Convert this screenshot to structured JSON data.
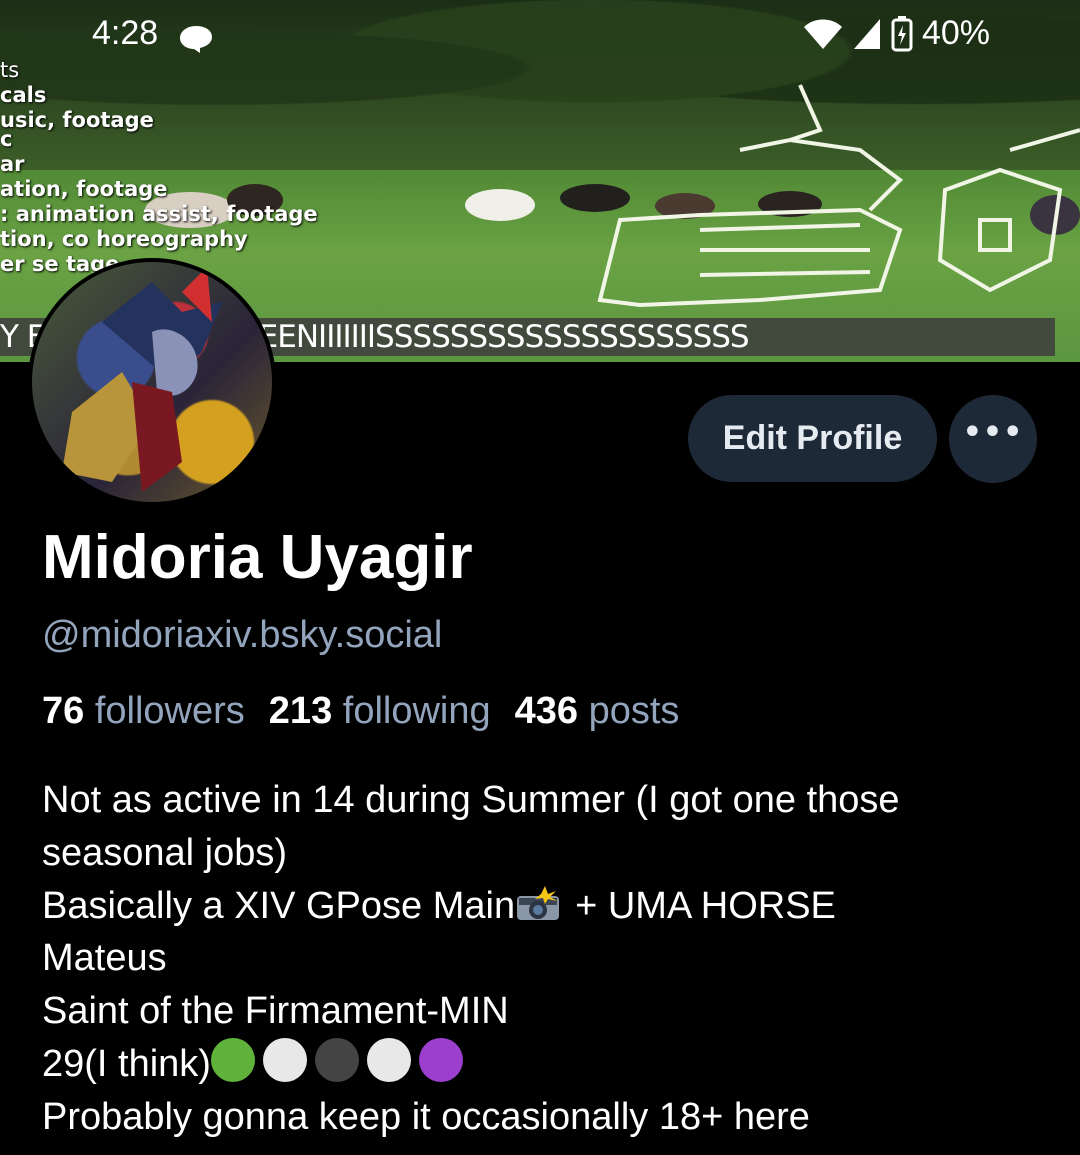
{
  "status_bar": {
    "time": "4:28",
    "battery": "40%"
  },
  "banner": {
    "credit_lines": [
      "ts",
      "cals",
      "usic, footage",
      "c",
      "ar",
      "ation, footage",
      ": animation assist, footage",
      "tion, co        horeography",
      "er se           tage"
    ],
    "scream_text": "Y E                   EEEEEEEEEEEEENIIIIIIISSSSSSSSSSSSSSSSSSSS"
  },
  "actions": {
    "edit_label": "Edit Profile",
    "more_label": "•••"
  },
  "profile": {
    "display_name": "Midoria Uyagir",
    "handle": "@midoriaxiv.bsky.social",
    "followers_count": "76",
    "followers_label": "followers",
    "following_count": "213",
    "following_label": "following",
    "posts_count": "436",
    "posts_label": "posts"
  },
  "bio": {
    "line1": "Not as active in 14 during Summer (I got one those",
    "line2": "seasonal jobs)",
    "line3a": "Basically a XIV GPose Main",
    "line3b": "+ UMA HORSE",
    "line4": "Mateus",
    "line5": "Saint of the Firmament-MIN",
    "line6": "29(I think)",
    "line7": "Probably gonna keep it occasionally 18+ here",
    "flag_colors": [
      "#5fb33a",
      "#e8e8e8",
      "#444444",
      "#e8e8e8",
      "#9c3fcf"
    ]
  },
  "colors": {
    "button_bg": "#1e2937",
    "muted_text": "#93a5bd"
  }
}
